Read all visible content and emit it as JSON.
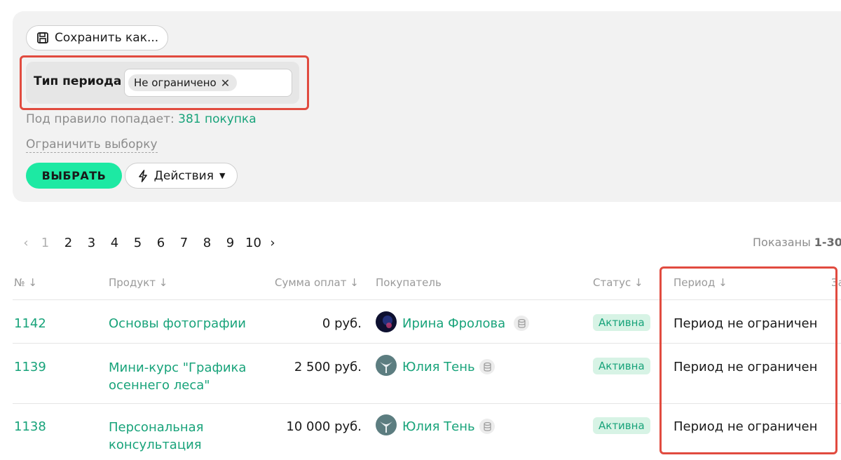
{
  "filter": {
    "save_label": "Сохранить как...",
    "period_type_label": "Тип периода",
    "period_tag": "Не ограничено",
    "rule_hint": "Под правило попадает:",
    "rule_count": "381 покупка",
    "limit_link": "Ограничить выборку",
    "select_label": "ВЫБРАТЬ",
    "actions_label": "Действия"
  },
  "pager": {
    "pages": [
      "1",
      "2",
      "3",
      "4",
      "5",
      "6",
      "7",
      "8",
      "9",
      "10"
    ],
    "current": "1",
    "shown_prefix": "Показаны",
    "shown_range": "1-30"
  },
  "table": {
    "headers": {
      "num": "№ ↓",
      "product": "Продукт ↓",
      "sum": "Сумма оплат ↓",
      "buyer": "Покупатель",
      "status": "Статус ↓",
      "period": "Период ↓",
      "next_partial": "За"
    },
    "rows": [
      {
        "num": "1142",
        "product": "Основы фотографии",
        "sum": "0 руб.",
        "buyer": "Ирина Фролова",
        "status": "Активна",
        "period": "Период не ограничен"
      },
      {
        "num": "1139",
        "product": "Мини-курс \"Графика осеннего леса\"",
        "sum": "2 500 руб.",
        "buyer": "Юлия Тень",
        "status": "Активна",
        "period": "Период не ограничен"
      },
      {
        "num": "1138",
        "product": "Персональная консультация",
        "sum": "10 000 руб.",
        "buyer": "Юлия Тень",
        "status": "Активна",
        "period": "Период не ограничен"
      }
    ]
  },
  "colors": {
    "accent_green": "#1de9a3",
    "link_green": "#18a37a",
    "highlight_red": "#e14b3f"
  },
  "icons": {
    "save": "floppy-disk-icon",
    "tag_remove": "close-icon",
    "actions": "lightning-icon",
    "dropdown": "chevron-down-icon",
    "prev": "chevron-left-icon",
    "next": "chevron-right-icon",
    "buyer_extra": "database-icon"
  }
}
